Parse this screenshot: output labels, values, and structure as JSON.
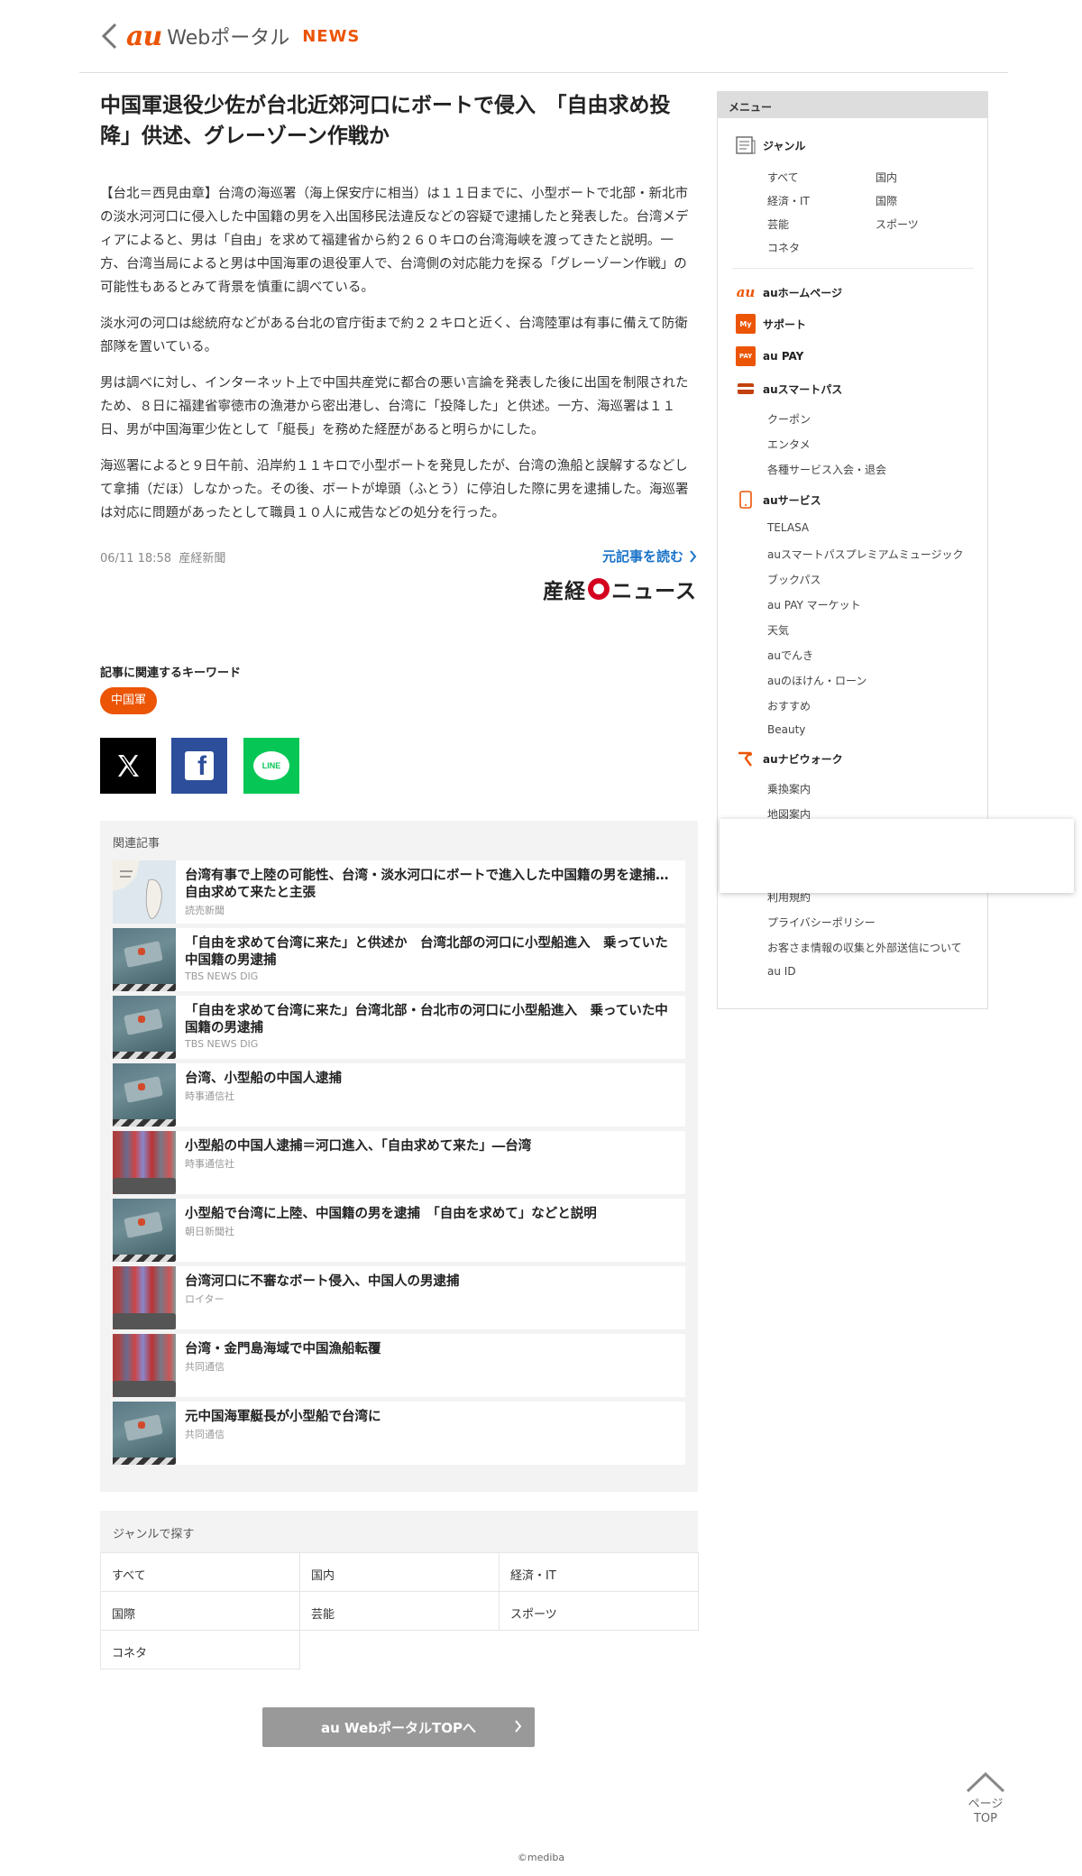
{
  "header": {
    "logo_au": "au",
    "logo_portal": "Webポータル",
    "logo_news": "NEWS"
  },
  "article": {
    "title": "中国軍退役少佐が台北近郊河口にボートで侵入　「自由求め投降」供述、グレーゾーン作戦か",
    "paragraphs": [
      "【台北＝西見由章】台湾の海巡署（海上保安庁に相当）は１１日までに、小型ボートで北部・新北市の淡水河河口に侵入した中国籍の男を入出国移民法違反などの容疑で逮捕したと発表した。台湾メディアによると、男は「自由」を求めて福建省から約２６０キロの台湾海峡を渡ってきたと説明。一方、台湾当局によると男は中国海軍の退役軍人で、台湾側の対応能力を探る「グレーゾーン作戦」の可能性もあるとみて背景を慎重に調べている。",
      "淡水河の河口は総統府などがある台北の官庁街まで約２２キロと近く、台湾陸軍は有事に備えて防衛部隊を置いている。",
      "男は調べに対し、インターネット上で中国共産党に都合の悪い言論を発表した後に出国を制限されたため、８日に福建省寧徳市の漁港から密出港し、台湾に「投降した」と供述。一方、海巡署は１１日、男が中国海軍少佐として「艇長」を務めた経歴があると明らかにした。",
      "海巡署によると９日午前、沿岸約１１キロで小型ボートを発見したが、台湾の漁船と誤解するなどして拿捕（だほ）しなかった。その後、ボートが埠頭（ふとう）に停泊した際に男を逮捕した。海巡署は対応に問題があったとして職員１０人に戒告などの処分を行った。"
    ],
    "meta": "06/11 18:58  産経新聞",
    "read_original": "元記事を読む",
    "publisher_a": "産経",
    "publisher_b": "ニュース"
  },
  "keywords": {
    "title": "記事に関連するキーワード",
    "tags": [
      "中国軍"
    ]
  },
  "share": {
    "x": "X",
    "facebook": "f",
    "line": "LINE"
  },
  "related": {
    "title": "関連記事",
    "items": [
      {
        "headline": "台湾有事で上陸の可能性、台湾・淡水河口にボートで進入した中国籍の男を逮捕…自由求めて来たと主張",
        "source": "読売新聞",
        "thumb": "map"
      },
      {
        "headline": "「自由を求めて台湾に来た」と供述か　台湾北部の河口に小型船進入　乗っていた中国籍の男逮捕",
        "source": "TBS NEWS DIG",
        "thumb": "boat"
      },
      {
        "headline": "「自由を求めて台湾に来た」台湾北部・台北市の河口に小型船進入　乗っていた中国籍の男逮捕",
        "source": "TBS NEWS DIG",
        "thumb": "boat"
      },
      {
        "headline": "台湾、小型船の中国人逮捕",
        "source": "時事通信社",
        "thumb": "boat"
      },
      {
        "headline": "小型船の中国人逮捕＝河口進入、「自由求めて来た」―台湾",
        "source": "時事通信社",
        "thumb": "flags"
      },
      {
        "headline": "小型船で台湾に上陸、中国籍の男を逮捕　「自由を求めて」などと説明",
        "source": "朝日新聞社",
        "thumb": "boat"
      },
      {
        "headline": "台湾河口に不審なボート侵入、中国人の男逮捕",
        "source": "ロイター",
        "thumb": "flags"
      },
      {
        "headline": "台湾・金門島海域で中国漁船転覆",
        "source": "共同通信",
        "thumb": "flags"
      },
      {
        "headline": "元中国海軍艇長が小型船で台湾に",
        "source": "共同通信",
        "thumb": "boat"
      }
    ]
  },
  "genre": {
    "title": "ジャンルで探す",
    "items": [
      "すべて",
      "国内",
      "経済・IT",
      "国際",
      "芸能",
      "スポーツ",
      "コネタ"
    ]
  },
  "top_button": "au WebポータルTOPへ",
  "page_top": {
    "line1": "ページ",
    "line2": "TOP"
  },
  "copyright": "©mediba",
  "sidebar": {
    "title": "メニュー",
    "genre_label": "ジャンル",
    "genre_col1": [
      "すべて",
      "経済・IT",
      "芸能",
      "コネタ"
    ],
    "genre_col2": [
      "国内",
      "国際",
      "スポーツ"
    ],
    "au_home": "auホームページ",
    "support": "サポート",
    "au_pay": "au PAY",
    "smartpass": "auスマートパス",
    "smartpass_items": [
      "クーポン",
      "エンタメ",
      "各種サービス入会・退会"
    ],
    "au_service": "auサービス",
    "service_items": [
      "TELASA",
      "auスマートパスプレミアムミュージック",
      "ブックパス",
      "au PAY マーケット",
      "天気",
      "auでんき",
      "auのほけん・ローン",
      "おすすめ",
      "Beauty"
    ],
    "navi_walk": "auナビウォーク",
    "navi_items": [
      "乗換案内",
      "地図案内"
    ],
    "footer_items": [
      "利用規約",
      "プライバシーポリシー",
      "お客さま情報の収集と外部送信について",
      "au ID"
    ],
    "icon_labels": {
      "my": "My",
      "au": "au",
      "pay": "PAY"
    }
  }
}
